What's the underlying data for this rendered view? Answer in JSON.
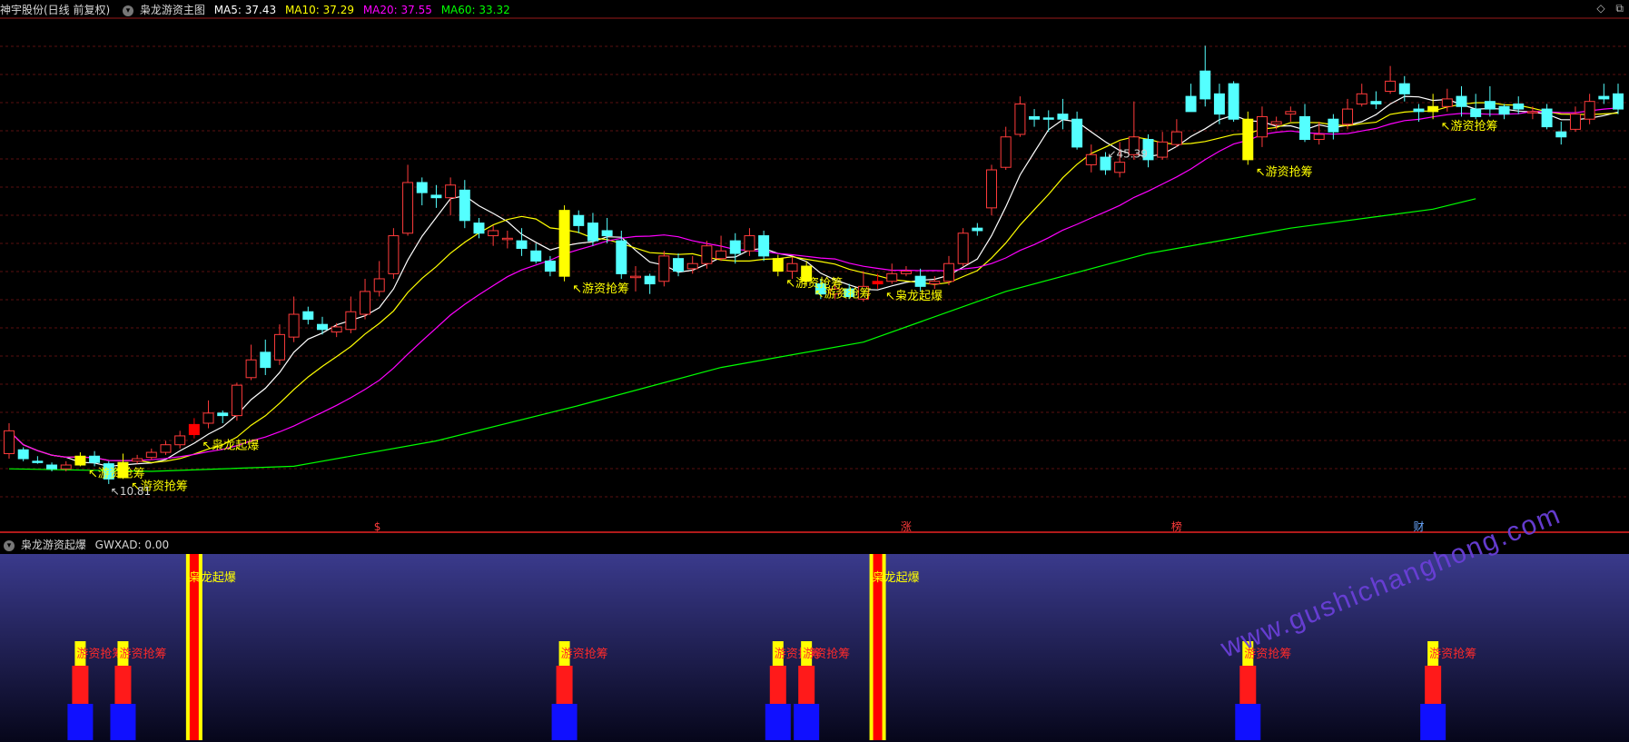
{
  "header": {
    "stock_name": "神宇股份(日线 前复权)",
    "indicator_name": "枭龙游资主图",
    "ma": [
      {
        "label": "MA5: 37.43",
        "color": "#ffffff"
      },
      {
        "label": "MA10: 37.29",
        "color": "#ffff00"
      },
      {
        "label": "MA20: 37.55",
        "color": "#ff00ff"
      },
      {
        "label": "MA60: 33.32",
        "color": "#00ff00"
      }
    ]
  },
  "sub_header": {
    "indicator_name": "枭龙游资起爆",
    "value_label": "GWXAD: 0.00"
  },
  "watermark": "www.gushichanghong.com",
  "chart_data": [
    {
      "type": "candlestick",
      "title": "枭龙游资主图",
      "ylim": [
        8,
        47
      ],
      "extremes": {
        "high": {
          "index": 77,
          "label": "45.39"
        },
        "low": {
          "index": 7,
          "label": "10.81"
        }
      },
      "candles": [
        [
          13.2,
          15.0,
          15.6,
          12.8
        ],
        [
          13.5,
          12.8,
          13.7,
          12.6
        ],
        [
          12.6,
          12.5,
          13.0,
          12.4
        ],
        [
          12.3,
          12.0,
          12.5,
          11.8
        ],
        [
          12.0,
          12.3,
          12.6,
          11.8
        ],
        [
          12.3,
          13.0,
          13.3,
          12.2
        ],
        [
          13.0,
          12.5,
          13.4,
          12.2
        ],
        [
          12.4,
          11.2,
          12.6,
          10.8
        ],
        [
          11.3,
          12.5,
          13.2,
          11.2
        ],
        [
          12.6,
          12.8,
          13.1,
          12.4
        ],
        [
          12.9,
          13.3,
          13.6,
          12.7
        ],
        [
          13.3,
          13.9,
          14.2,
          13.1
        ],
        [
          13.9,
          14.6,
          15.0,
          13.6
        ],
        [
          14.7,
          15.5,
          16.0,
          14.4
        ],
        [
          15.6,
          16.4,
          17.4,
          15.2
        ],
        [
          16.4,
          16.2,
          16.6,
          15.6
        ],
        [
          16.2,
          18.6,
          18.8,
          15.8
        ],
        [
          19.2,
          20.6,
          21.8,
          19.0
        ],
        [
          21.2,
          20.0,
          22.2,
          19.4
        ],
        [
          20.6,
          22.6,
          23.4,
          20.2
        ],
        [
          22.4,
          24.2,
          25.6,
          22.0
        ],
        [
          24.4,
          23.8,
          24.8,
          23.4
        ],
        [
          23.4,
          23.0,
          24.0,
          22.6
        ],
        [
          22.8,
          23.2,
          23.5,
          22.4
        ],
        [
          23.0,
          24.4,
          25.6,
          22.7
        ],
        [
          24.2,
          26.0,
          27.0,
          23.8
        ],
        [
          26.0,
          27.0,
          28.4,
          25.6
        ],
        [
          27.4,
          30.4,
          31.0,
          27.0
        ],
        [
          30.6,
          34.6,
          36.0,
          30.4
        ],
        [
          34.6,
          33.8,
          35.0,
          32.8
        ],
        [
          33.6,
          33.4,
          34.4,
          32.6
        ],
        [
          33.4,
          34.4,
          35.0,
          32.0
        ],
        [
          34.0,
          31.6,
          34.8,
          31.0
        ],
        [
          31.4,
          30.6,
          31.8,
          30.2
        ],
        [
          30.4,
          30.8,
          31.2,
          29.6
        ],
        [
          30.2,
          30.2,
          30.8,
          29.4
        ],
        [
          30.0,
          29.4,
          31.0,
          28.8
        ],
        [
          29.2,
          28.4,
          29.8,
          28.2
        ],
        [
          28.4,
          27.6,
          28.8,
          27.2
        ],
        [
          27.2,
          32.4,
          32.8,
          26.8
        ],
        [
          32.0,
          31.2,
          32.4,
          30.6
        ],
        [
          31.4,
          30.0,
          32.2,
          29.6
        ],
        [
          30.8,
          30.4,
          31.8,
          29.8
        ],
        [
          30.0,
          27.4,
          30.8,
          27.0
        ],
        [
          27.2,
          27.2,
          28.0,
          26.0
        ],
        [
          27.2,
          26.6,
          27.4,
          25.8
        ],
        [
          26.8,
          28.8,
          29.2,
          26.4
        ],
        [
          28.6,
          27.6,
          29.0,
          27.2
        ],
        [
          27.8,
          28.2,
          28.8,
          27.4
        ],
        [
          28.2,
          29.6,
          30.0,
          27.8
        ],
        [
          28.6,
          29.2,
          30.4,
          28.4
        ],
        [
          30.0,
          29.0,
          30.6,
          28.2
        ],
        [
          29.2,
          30.4,
          31.0,
          28.8
        ],
        [
          30.4,
          28.8,
          30.8,
          28.4
        ],
        [
          28.6,
          27.6,
          28.9,
          27.2
        ],
        [
          27.6,
          28.2,
          28.7,
          27.0
        ],
        [
          28.0,
          26.8,
          28.4,
          26.4
        ],
        [
          26.6,
          25.8,
          27.0,
          25.4
        ],
        [
          25.8,
          26.2,
          26.6,
          25.4
        ],
        [
          26.2,
          25.6,
          26.6,
          25.4
        ],
        [
          25.4,
          26.4,
          27.6,
          25.2
        ],
        [
          26.8,
          26.6,
          27.4,
          26.2
        ],
        [
          26.8,
          27.4,
          28.2,
          26.6
        ],
        [
          27.4,
          27.6,
          28.0,
          27.2
        ],
        [
          27.2,
          26.4,
          27.8,
          26.0
        ],
        [
          26.6,
          26.8,
          27.2,
          26.2
        ],
        [
          26.8,
          28.2,
          28.8,
          26.5
        ],
        [
          28.2,
          30.6,
          31.0,
          28.0
        ],
        [
          31.0,
          30.8,
          31.4,
          30.4
        ],
        [
          32.6,
          35.6,
          36.0,
          32.0
        ],
        [
          35.8,
          38.2,
          39.0,
          35.6
        ],
        [
          38.4,
          40.8,
          41.4,
          38.2
        ],
        [
          39.8,
          39.6,
          40.4,
          39.0
        ],
        [
          39.7,
          39.6,
          40.3,
          38.6
        ],
        [
          40.0,
          39.6,
          41.2,
          38.8
        ],
        [
          39.6,
          37.4,
          40.2,
          37.2
        ],
        [
          36.0,
          36.8,
          37.6,
          35.4
        ],
        [
          36.6,
          35.6,
          37.0,
          35.2
        ],
        [
          35.4,
          36.2,
          37.8,
          35.0
        ],
        [
          36.8,
          38.2,
          41.0,
          36.4
        ],
        [
          38.0,
          36.4,
          38.4,
          35.8
        ],
        [
          36.6,
          37.8,
          38.6,
          36.4
        ],
        [
          37.6,
          38.6,
          39.6,
          37.4
        ],
        [
          41.4,
          40.2,
          42.4,
          40.2
        ],
        [
          43.4,
          41.2,
          45.4,
          40.6
        ],
        [
          41.6,
          40.0,
          42.4,
          39.2
        ],
        [
          42.4,
          39.6,
          42.6,
          39.4
        ],
        [
          39.6,
          36.4,
          40.2,
          36.0
        ],
        [
          38.2,
          39.8,
          40.6,
          37.4
        ],
        [
          39.2,
          39.4,
          39.8,
          38.8
        ],
        [
          40.0,
          40.2,
          40.6,
          39.4
        ],
        [
          39.8,
          38.0,
          40.8,
          37.8
        ],
        [
          38.0,
          38.4,
          39.4,
          37.6
        ],
        [
          39.6,
          38.6,
          40.0,
          38.0
        ],
        [
          39.2,
          40.4,
          41.2,
          38.8
        ],
        [
          40.8,
          41.6,
          42.4,
          40.6
        ],
        [
          41.0,
          40.8,
          41.8,
          40.4
        ],
        [
          41.8,
          42.6,
          43.8,
          41.6
        ],
        [
          42.4,
          41.6,
          43.0,
          41.0
        ],
        [
          40.4,
          40.2,
          40.8,
          39.4
        ],
        [
          40.6,
          40.2,
          41.6,
          39.6
        ],
        [
          40.6,
          41.2,
          42.0,
          40.2
        ],
        [
          41.4,
          40.6,
          42.2,
          39.8
        ],
        [
          40.4,
          39.8,
          41.6,
          39.6
        ],
        [
          41.0,
          40.4,
          42.2,
          39.8
        ],
        [
          40.6,
          40.0,
          40.8,
          39.6
        ],
        [
          40.8,
          40.4,
          41.4,
          40.0
        ],
        [
          40.2,
          40.2,
          40.6,
          39.6
        ],
        [
          40.4,
          39.0,
          40.8,
          38.8
        ],
        [
          38.6,
          38.2,
          39.4,
          37.6
        ],
        [
          38.8,
          40.0,
          40.6,
          38.6
        ],
        [
          39.6,
          41.0,
          41.6,
          39.2
        ],
        [
          41.4,
          41.2,
          42.4,
          40.8
        ],
        [
          41.6,
          40.4,
          42.4,
          40.0
        ]
      ],
      "markers": [
        {
          "index": 5,
          "label": "游资抢筹",
          "color": "#ffff00"
        },
        {
          "index": 8,
          "label": "游资抢筹",
          "color": "#ffff00"
        },
        {
          "index": 13,
          "label": "枭龙起爆",
          "color": "#ffff00"
        },
        {
          "index": 39,
          "label": "游资抢筹",
          "color": "#ffff00"
        },
        {
          "index": 54,
          "label": "游资抢筹",
          "color": "#ffff00"
        },
        {
          "index": 56,
          "label": "游资抢筹",
          "color": "#ffff00"
        },
        {
          "index": 61,
          "label": "枭龙起爆",
          "color": "#ffff00"
        },
        {
          "index": 87,
          "label": "游资抢筹",
          "color": "#ffff00"
        },
        {
          "index": 100,
          "label": "游资抢筹",
          "color": "#ffff00"
        }
      ],
      "event_tags": [
        {
          "index": 26,
          "label": "$",
          "color": "#ff3b3b"
        },
        {
          "index": 63,
          "label": "涨",
          "color": "#ff3b3b"
        },
        {
          "index": 82,
          "label": "榜",
          "color": "#ff3b3b"
        },
        {
          "index": 99,
          "label": "财",
          "color": "#6aa8ff"
        }
      ],
      "series": [
        {
          "name": "MA5",
          "color": "#ffffff"
        },
        {
          "name": "MA10",
          "color": "#ffff00"
        },
        {
          "name": "MA20",
          "color": "#ff00ff"
        },
        {
          "name": "MA60",
          "color": "#00ff00",
          "points": [
            [
              0,
              12.0
            ],
            [
              10,
              11.8
            ],
            [
              20,
              12.2
            ],
            [
              30,
              14.2
            ],
            [
              40,
              17.0
            ],
            [
              50,
              20.0
            ],
            [
              60,
              22.0
            ],
            [
              70,
              26.0
            ],
            [
              80,
              29.0
            ],
            [
              90,
              31.0
            ],
            [
              100,
              32.5
            ],
            [
              103,
              33.32
            ]
          ]
        }
      ],
      "grid": true
    },
    {
      "type": "bar",
      "title": "枭龙游资起爆",
      "signals": [
        {
          "index": 5,
          "kind": "游资抢筹",
          "label": "游资抢筹"
        },
        {
          "index": 8,
          "kind": "游资抢筹",
          "label": "游资抢筹"
        },
        {
          "index": 13,
          "kind": "枭龙起爆",
          "label": "枭龙起爆"
        },
        {
          "index": 39,
          "kind": "游资抢筹",
          "label": "游资抢筹"
        },
        {
          "index": 54,
          "kind": "游资抢筹",
          "label": "游资抢筹"
        },
        {
          "index": 56,
          "kind": "游资抢筹",
          "label": "游资抢筹"
        },
        {
          "index": 61,
          "kind": "枭龙起爆",
          "label": "枭龙起爆"
        },
        {
          "index": 87,
          "kind": "游资抢筹",
          "label": "游资抢筹"
        },
        {
          "index": 100,
          "kind": "游资抢筹",
          "label": "游资抢筹"
        }
      ]
    }
  ]
}
